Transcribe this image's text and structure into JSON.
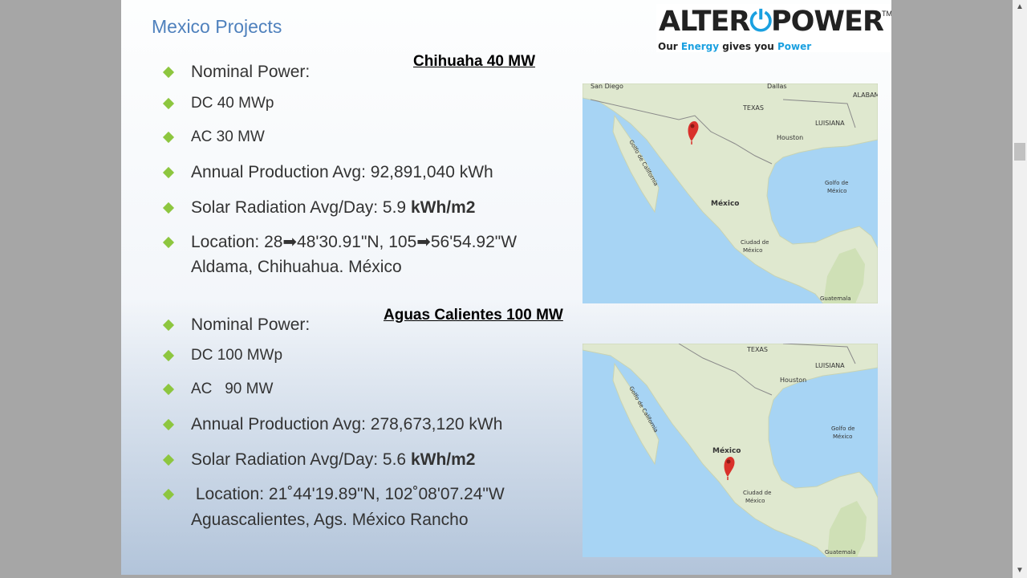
{
  "slide": {
    "title": "Mexico Projects"
  },
  "logo": {
    "part1": "ALTER",
    "part2": "POWER",
    "tm": "TM",
    "tag_a": "Our ",
    "tag_b": "Energy",
    "tag_c": " gives you ",
    "tag_d": "Power"
  },
  "projects": [
    {
      "title": "Chihuaha 40 MW",
      "nominal": "Nominal Power:",
      "dc": "DC 40 MWp",
      "ac": "AC 30 MW",
      "annual": "Annual Production Avg: 92,891,040 kWh",
      "solar_prefix": "Solar Radiation Avg/Day: 5.9 ",
      "solar_unit": "kWh/m2",
      "location_line1": "Location: 28➡48'30.91\"N, 105➡56'54.92\"W",
      "location_line2": "Aldama, Chihuahua. México"
    },
    {
      "title": "Aguas Calientes 100 MW",
      "nominal": "Nominal Power:",
      "dc": "DC 100 MWp",
      "ac": "AC   90 MW",
      "annual": "Annual Production Avg: 278,673,120 kWh",
      "solar_prefix": "Solar Radiation Avg/Day: 5.6 ",
      "solar_unit": "kWh/m2",
      "location_line1": " Location: 21˚44'19.89\"N, 102˚08'07.24\"W",
      "location_line2": "Aguascalientes, Ags. México Rancho"
    }
  ],
  "map1": {
    "san_diego": "San Diego",
    "dallas": "Dallas",
    "texas": "TEXAS",
    "alabama": "ALABAM",
    "luisiana": "LUISIANA",
    "houston": "Houston",
    "golfo": "Golfo de",
    "golfo2": "México",
    "golfo_ca": "Golfo de California",
    "mexico": "México",
    "ciudad": "Ciudad de",
    "ciudad2": "México",
    "guatemala": "Guatemala"
  },
  "map2": {
    "texas": "TEXAS",
    "luisiana": "LUISIANA",
    "houston": "Houston",
    "golfo": "Golfo de",
    "golfo2": "México",
    "golfo_ca": "Golfo de California",
    "mexico": "México",
    "ciudad": "Ciudad de",
    "ciudad2": "México",
    "guatemala": "Guatemala"
  }
}
